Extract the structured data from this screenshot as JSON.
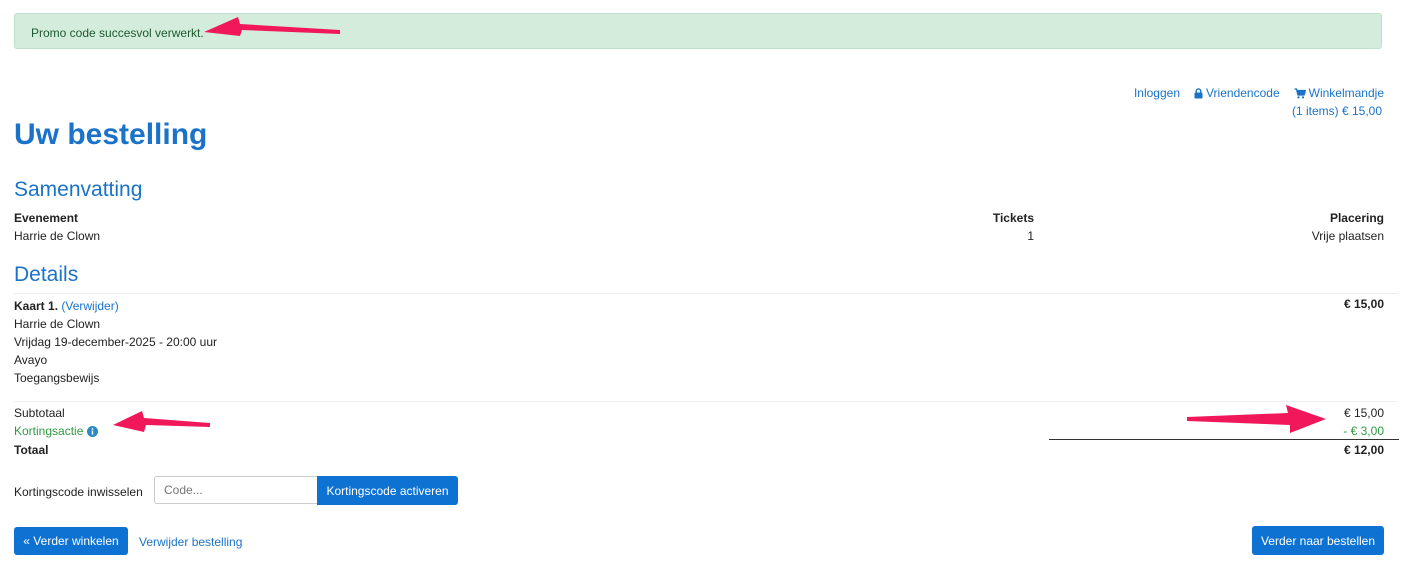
{
  "alert": {
    "message": "Promo code succesvol verwerkt."
  },
  "topnav": {
    "login": "Inloggen",
    "friend_code": "Vriendencode",
    "cart": "Winkelmandje",
    "cart_summary": "(1 items) € 15,00"
  },
  "page_title": "Uw bestelling",
  "summary": {
    "heading": "Samenvatting",
    "col_event": "Evenement",
    "col_tickets": "Tickets",
    "col_placement": "Placering",
    "event": "Harrie de Clown",
    "tickets": "1",
    "placement": "Vrije plaatsen"
  },
  "details": {
    "heading": "Details",
    "card_label": "Kaart 1.",
    "remove_link": "(Verwijder)",
    "event": "Harrie de Clown",
    "datetime": "Vrijdag 19-december-2025 - 20:00 uur",
    "venue": "Avayo",
    "type": "Toegangsbewijs",
    "price": "€ 15,00"
  },
  "totals": {
    "subtotal_label": "Subtotaal",
    "subtotal": "€ 15,00",
    "discount_label": "Kortingsactie",
    "discount": "- € 3,00",
    "total_label": "Totaal",
    "total": "€ 12,00"
  },
  "coupon": {
    "label": "Kortingscode inwisselen",
    "placeholder": "Code...",
    "button": "Kortingscode activeren"
  },
  "footer": {
    "continue_shopping": "« Verder winkelen",
    "delete_order": "Verwijder bestelling",
    "checkout": "Verder naar bestellen"
  },
  "colors": {
    "accent": "#1a73c9",
    "button": "#0e72d3",
    "success_bg": "#d4ecdc",
    "discount": "#2f9a44",
    "annotation_arrow": "#f0185a"
  }
}
